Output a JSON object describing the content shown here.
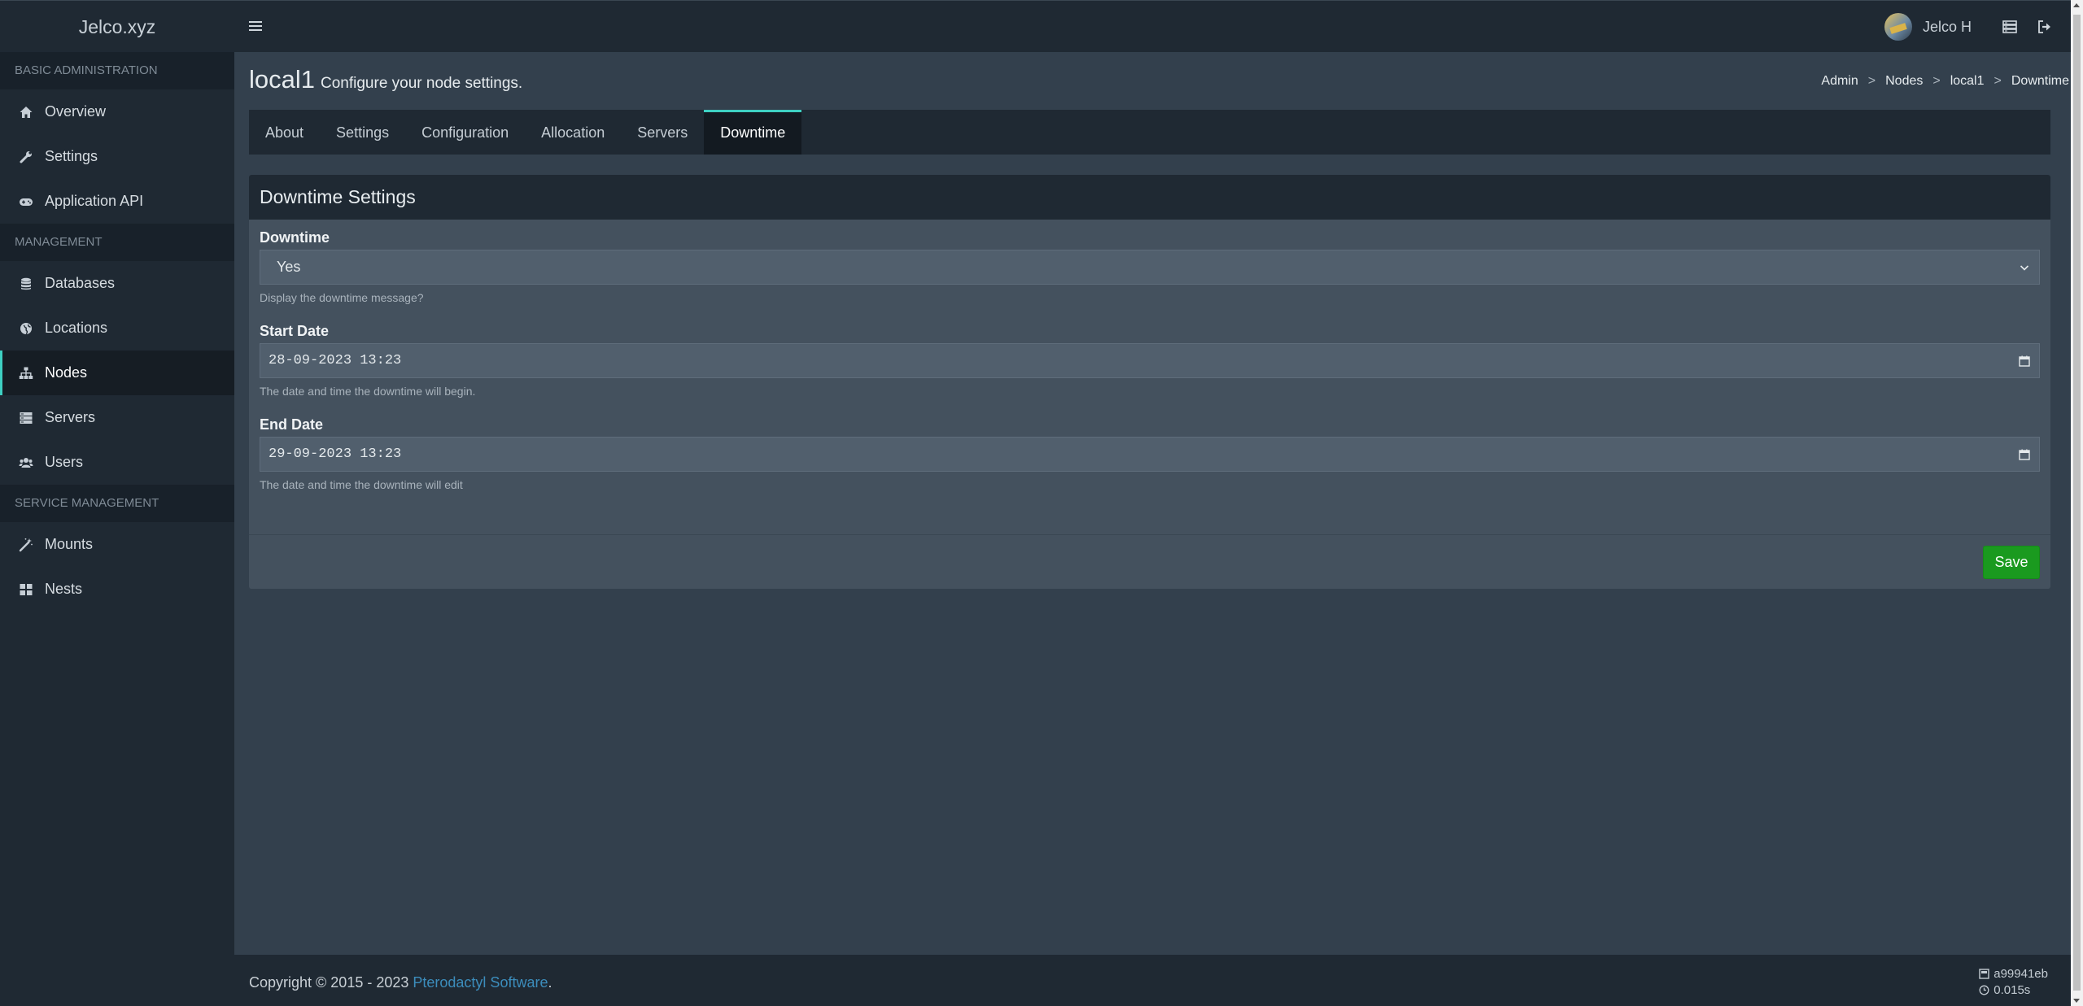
{
  "topbar": {
    "brand": "Jelco.xyz",
    "user_name": "Jelco H"
  },
  "sidebar": {
    "sections": [
      {
        "header": "Basic Administration",
        "items": [
          {
            "label": "Overview",
            "icon": "home-icon"
          },
          {
            "label": "Settings",
            "icon": "wrench-icon"
          },
          {
            "label": "Application API",
            "icon": "gamepad-icon"
          }
        ]
      },
      {
        "header": "Management",
        "items": [
          {
            "label": "Databases",
            "icon": "database-icon"
          },
          {
            "label": "Locations",
            "icon": "globe-icon"
          },
          {
            "label": "Nodes",
            "icon": "sitemap-icon",
            "active": true
          },
          {
            "label": "Servers",
            "icon": "server-icon"
          },
          {
            "label": "Users",
            "icon": "users-icon"
          }
        ]
      },
      {
        "header": "Service Management",
        "items": [
          {
            "label": "Mounts",
            "icon": "magic-icon"
          },
          {
            "label": "Nests",
            "icon": "th-large-icon"
          }
        ]
      }
    ]
  },
  "header": {
    "title": "local1",
    "subtitle": "Configure your node settings.",
    "breadcrumb": [
      "Admin",
      "Nodes",
      "local1",
      "Downtime"
    ],
    "breadcrumb_separator": ">"
  },
  "tabs": [
    {
      "label": "About"
    },
    {
      "label": "Settings"
    },
    {
      "label": "Configuration"
    },
    {
      "label": "Allocation"
    },
    {
      "label": "Servers"
    },
    {
      "label": "Downtime",
      "active": true
    }
  ],
  "form": {
    "title": "Downtime Settings",
    "downtime": {
      "label": "Downtime",
      "value": "Yes",
      "help": "Display the downtime message?"
    },
    "start_date": {
      "label": "Start Date",
      "value": "28-09-2023 13:23",
      "help": "The date and time the downtime will begin."
    },
    "end_date": {
      "label": "End Date",
      "value": "29-09-2023 13:23",
      "help": "The date and time the downtime will edit"
    },
    "save_label": "Save"
  },
  "footer": {
    "copyright_prefix": "Copyright © 2015 - 2023 ",
    "link_text": "Pterodactyl Software",
    "copyright_suffix": ".",
    "version": "a99941eb",
    "render_time": "0.015s"
  },
  "colors": {
    "accent": "#3ed0c2",
    "save_button": "#1a9a1f",
    "link": "#3c8dbc",
    "background": "#33404d",
    "panel": "#1f2933"
  }
}
